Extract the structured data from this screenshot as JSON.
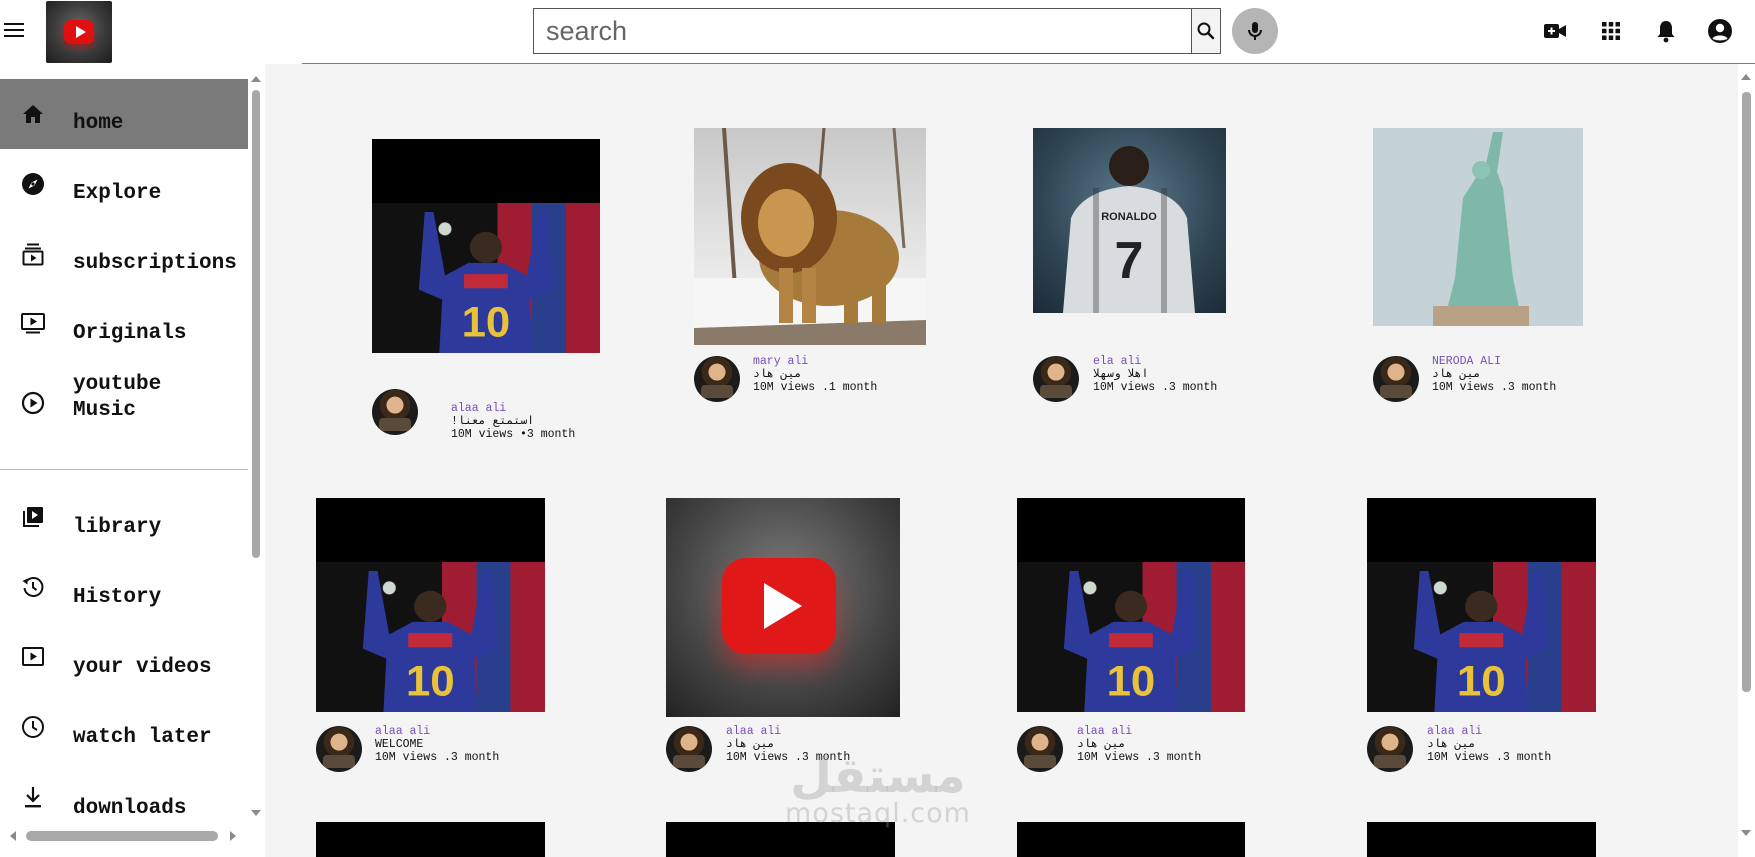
{
  "header": {
    "search_placeholder": "search",
    "icons": [
      "menu-icon",
      "youtube-logo",
      "search-icon",
      "mic-icon",
      "video-camera-plus-icon",
      "apps-grid-icon",
      "bell-icon",
      "account-icon"
    ]
  },
  "sidebar": {
    "items": [
      {
        "label": "home",
        "icon": "home-icon",
        "active": true
      },
      {
        "label": "Explore",
        "icon": "compass-icon"
      },
      {
        "label": "subscriptions",
        "icon": "subscriptions-icon"
      },
      {
        "label": "Originals",
        "icon": "originals-icon"
      },
      {
        "label": "youtube",
        "label2": "Music",
        "icon": "play-circle-icon"
      },
      {
        "label": "library",
        "icon": "library-icon"
      },
      {
        "label": "History",
        "icon": "history-icon"
      },
      {
        "label": "your videos",
        "icon": "your-videos-icon"
      },
      {
        "label": "watch later",
        "icon": "clock-icon"
      },
      {
        "label": "downloads",
        "icon": "download-icon"
      }
    ]
  },
  "videos": [
    {
      "channel": "alaa ali",
      "title": "!استمتع معنا",
      "views": "10M views •3 month",
      "thumb": "messi"
    },
    {
      "channel": "mary ali",
      "title": "مين هاد",
      "views": "10M views .1 month",
      "thumb": "lion"
    },
    {
      "channel": "ela ali",
      "title": "اهلا وسهلا",
      "views": "10M views .3 month",
      "thumb": "ronaldo"
    },
    {
      "channel": "NERODA ALI",
      "title": "مين هاد",
      "views": "10M views .3 month",
      "thumb": "liberty"
    },
    {
      "channel": "alaa ali",
      "title": "WELCOME",
      "views": "10M views .3 month",
      "thumb": "messi"
    },
    {
      "channel": "alaa ali",
      "title": "مين هاد",
      "views": "10M views .3 month",
      "thumb": "youtube"
    },
    {
      "channel": "alaa ali",
      "title": "مين هاد",
      "views": "10M views .3 month",
      "thumb": "messi"
    },
    {
      "channel": "alaa ali",
      "title": "مين هاد",
      "views": "10M views .3 month",
      "thumb": "messi"
    }
  ],
  "watermark": {
    "arabic": "مستقل",
    "latin": "mostaql.com"
  },
  "colors": {
    "accent_red": "#e01010",
    "channel_purple": "#7a4fb5",
    "active_nav": "#7a7a7a",
    "content_bg": "#f4f4f4"
  }
}
